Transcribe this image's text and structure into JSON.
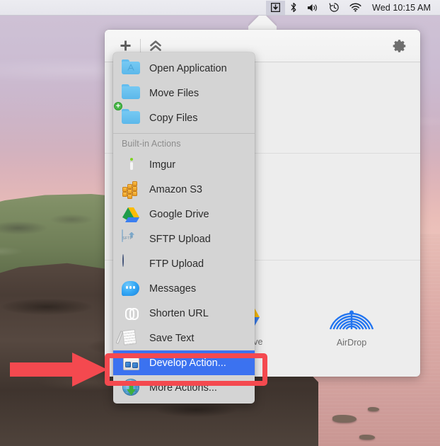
{
  "menubar": {
    "icons": [
      {
        "name": "dropzone-icon",
        "glyph": "⬇",
        "active": true
      },
      {
        "name": "bluetooth-icon",
        "glyph": "B"
      },
      {
        "name": "volume-icon",
        "glyph": "🔊"
      },
      {
        "name": "time-machine-icon",
        "glyph": "↺"
      },
      {
        "name": "wifi-icon",
        "glyph": "W"
      }
    ],
    "clock": "Wed 10:15 AM"
  },
  "panel": {
    "toolbar": {
      "add_label": "+",
      "collapse_label": "^",
      "settings_label": "gear"
    },
    "destinations": [
      {
        "label": "Google Drive",
        "icon": "google-drive-icon"
      },
      {
        "label": "AirDrop",
        "icon": "airdrop-icon"
      }
    ]
  },
  "menu": {
    "top_items": [
      {
        "label": "Open Application",
        "icon": "folder-app-icon"
      },
      {
        "label": "Move Files",
        "icon": "folder-move-icon"
      },
      {
        "label": "Copy Files",
        "icon": "folder-copy-icon"
      }
    ],
    "section_header": "Built-in Actions",
    "actions": [
      {
        "label": "Imgur",
        "icon": "imgur-icon"
      },
      {
        "label": "Amazon S3",
        "icon": "amazon-s3-icon"
      },
      {
        "label": "Google Drive",
        "icon": "google-drive-icon"
      },
      {
        "label": "SFTP Upload",
        "icon": "sftp-upload-icon"
      },
      {
        "label": "FTP Upload",
        "icon": "ftp-upload-icon"
      },
      {
        "label": "Messages",
        "icon": "messages-icon"
      },
      {
        "label": "Shorten URL",
        "icon": "shorten-url-icon"
      },
      {
        "label": "Save Text",
        "icon": "save-text-icon"
      },
      {
        "label": "Develop Action...",
        "icon": "develop-action-icon",
        "selected": true
      },
      {
        "label": "More Actions...",
        "icon": "more-actions-icon"
      }
    ]
  },
  "annotation": {
    "color": "#f4494f",
    "highlight_target": "Develop Action..."
  },
  "colors": {
    "selection_blue": "#3b72f0",
    "annotation_red": "#f4494f",
    "menu_bg": "#d4d4d4",
    "panel_bg": "#ededed"
  }
}
